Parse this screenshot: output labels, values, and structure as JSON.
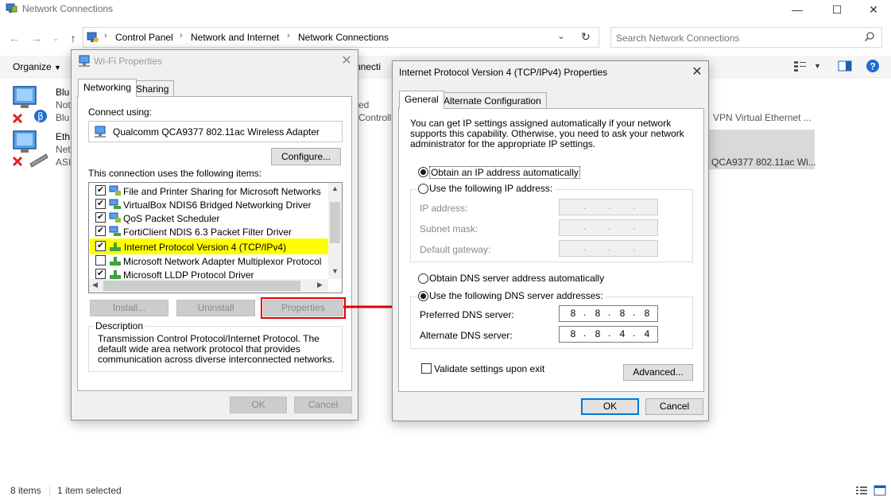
{
  "explorer": {
    "window_title": "Network Connections",
    "breadcrumbs": [
      "Control Panel",
      "Network and Internet",
      "Network Connections"
    ],
    "search_placeholder": "Search Network Connections",
    "ribbon": {
      "organize_label": "Organize",
      "partial_label": "nnecti"
    },
    "background_items": {
      "item1_name": "Blu",
      "item1_l2": "Not",
      "item1_l3": "Blu",
      "item2_name": "Eth",
      "item2_l2": "Net",
      "item2_l3": "ASI",
      "item3_l2": "ed",
      "item3_l3": "Controlle",
      "item4_l3": "VPN Virtual Ethernet ...",
      "item5_l3": "QCA9377 802.11ac Wi..."
    },
    "status": {
      "count": "8 items",
      "selected": "1 item selected"
    },
    "colors": {
      "accent": "#0078d7",
      "selection": "#cce8ff"
    }
  },
  "wifi_dialog": {
    "title": "Wi-Fi Properties",
    "tabs": [
      "Networking",
      "Sharing"
    ],
    "connect_using_label": "Connect using:",
    "adapter_name": "Qualcomm QCA9377 802.11ac Wireless Adapter",
    "configure_label": "Configure...",
    "items_label": "This connection uses the following items:",
    "items": [
      {
        "label": "File and Printer Sharing for Microsoft Networks",
        "checked": "✔"
      },
      {
        "label": "VirtualBox NDIS6 Bridged Networking Driver",
        "checked": "✔"
      },
      {
        "label": "QoS Packet Scheduler",
        "checked": "✔"
      },
      {
        "label": "FortiClient NDIS 6.3 Packet Filter Driver",
        "checked": "✔"
      },
      {
        "label": "Internet Protocol Version 4 (TCP/IPv4)",
        "checked": "✔"
      },
      {
        "label": "Microsoft Network Adapter Multiplexor Protocol",
        "checked": ""
      },
      {
        "label": "Microsoft LLDP Protocol Driver",
        "checked": "✔"
      }
    ],
    "install_label": "Install...",
    "uninstall_label": "Uninstall",
    "properties_label": "Properties",
    "description_title": "Description",
    "description_text": "Transmission Control Protocol/Internet Protocol. The default wide area network protocol that provides communication across diverse interconnected networks.",
    "ok_label": "OK",
    "cancel_label": "Cancel",
    "highlight_color": "#ffff00",
    "callout_color": "#e00000"
  },
  "ipv4_dialog": {
    "title": "Internet Protocol Version 4 (TCP/IPv4) Properties",
    "tabs": [
      "General",
      "Alternate Configuration"
    ],
    "intro": "You can get IP settings assigned automatically if your network supports this capability. Otherwise, you need to ask your network administrator for the appropriate IP settings.",
    "obtain_ip_auto": "Obtain an IP address automatically",
    "use_following_ip": "Use the following IP address:",
    "ip_address_label": "IP address:",
    "subnet_label": "Subnet mask:",
    "gateway_label": "Default gateway:",
    "obtain_dns_auto": "Obtain DNS server address automatically",
    "use_following_dns": "Use the following DNS server addresses:",
    "preferred_dns_label": "Preferred DNS server:",
    "alternate_dns_label": "Alternate DNS server:",
    "preferred_dns": [
      "8",
      "8",
      "8",
      "8"
    ],
    "alternate_dns": [
      "8",
      "8",
      "4",
      "4"
    ],
    "validate_label": "Validate settings upon exit",
    "advanced_label": "Advanced...",
    "ok_label": "OK",
    "cancel_label": "Cancel"
  }
}
